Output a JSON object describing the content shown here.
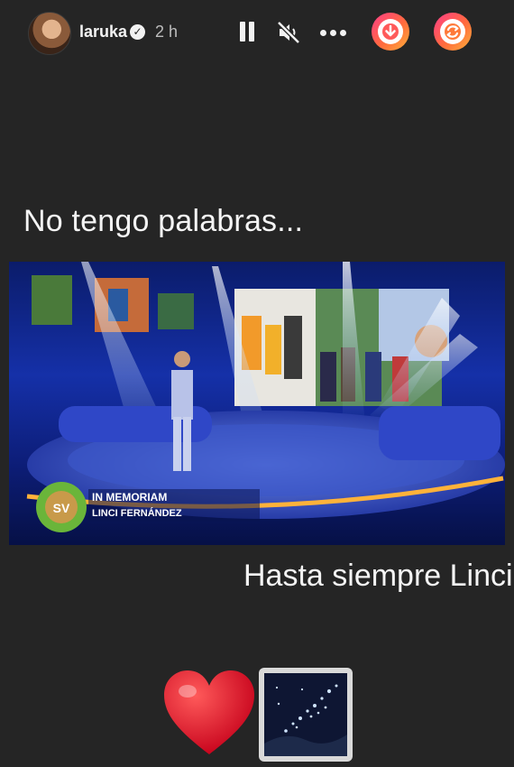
{
  "story_header": {
    "username": "laruka",
    "time_ago": "2 h",
    "icons": [
      "avatar",
      "verified-badge-icon",
      "pause-icon",
      "mute-icon",
      "more-icon",
      "download-sticker-icon",
      "repost-sticker-icon"
    ]
  },
  "captions": {
    "top": "No tengo palabras...",
    "bottom": "Hasta siempre Linci"
  },
  "photo": {
    "overlay_title": "IN MEMORIAM",
    "overlay_name": "LINCI FERNÁNDEZ",
    "logo_text": "SV"
  },
  "emojis": [
    "heart-emoji",
    "night-stars-emoji"
  ],
  "colors": {
    "background": "#252525",
    "accent_gradient_start": "#ff3d8a",
    "accent_gradient_end": "#ffb13a",
    "heart": "#e0162b"
  }
}
